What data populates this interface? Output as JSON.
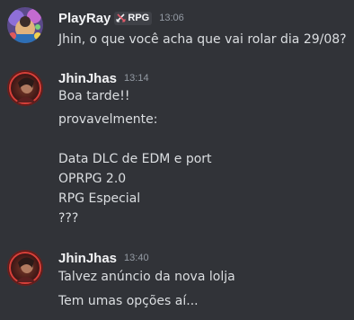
{
  "messages": [
    {
      "username": "PlayRay",
      "role_tag": "RPG",
      "role_icon": "swords-icon",
      "timestamp": "13:06",
      "lines": [
        "Jhin, o que você acha que vai rolar dia 29/08?"
      ]
    },
    {
      "username": "JhinJhas",
      "timestamp": "13:14",
      "lines": [
        "Boa tarde!!",
        "provavelmente:",
        "Data DLC de EDM e port",
        "OPRPG 2.0",
        "RPG Especial",
        "???"
      ]
    },
    {
      "username": "JhinJhas",
      "timestamp": "13:40",
      "lines": [
        "Talvez anúncio da nova lolja",
        "Tem umas opções aí..."
      ]
    }
  ],
  "colors": {
    "background": "#313338",
    "username": "#f2f3f5",
    "text": "#dbdee1",
    "timestamp": "#949ba4",
    "tag_background": "#3f4147"
  }
}
